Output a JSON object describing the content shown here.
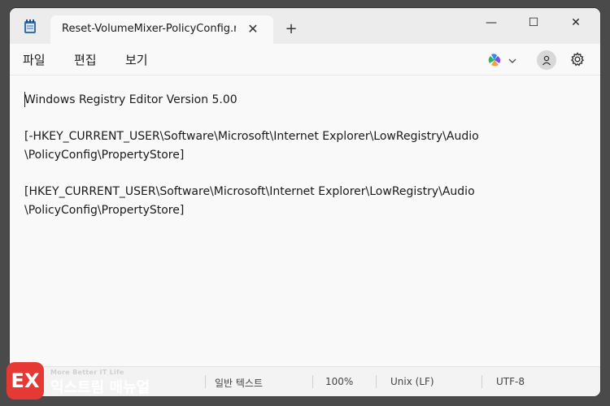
{
  "window": {
    "tab_title": "Reset-VolumeMixer-PolicyConfig.r",
    "tab_close_glyph": "✕",
    "new_tab_glyph": "+",
    "minimize_glyph": "—",
    "maximize_glyph": "☐",
    "close_glyph": "✕"
  },
  "menu": {
    "file": "파일",
    "edit": "편집",
    "view": "보기"
  },
  "editor": {
    "lines": [
      "Windows Registry Editor Version 5.00",
      "[-HKEY_CURRENT_USER\\Software\\Microsoft\\Internet Explorer\\LowRegistry\\Audio",
      "\\PolicyConfig\\PropertyStore]",
      "[HKEY_CURRENT_USER\\Software\\Microsoft\\Internet Explorer\\LowRegistry\\Audio",
      "\\PolicyConfig\\PropertyStore]"
    ]
  },
  "status": {
    "text_type": "일반 텍스트",
    "zoom": "100%",
    "line_ending": "Unix (LF)",
    "encoding": "UTF-8"
  },
  "watermark": {
    "logo_text": "EX",
    "tagline": "More Better IT Life",
    "name": "익스트림 매뉴얼"
  },
  "icons": {
    "app": "notepad-icon",
    "copilot": "copilot-icon",
    "account": "account-icon",
    "settings": "gear-icon"
  },
  "colors": {
    "accent": "#e53935",
    "background": "#f9f9f9"
  }
}
